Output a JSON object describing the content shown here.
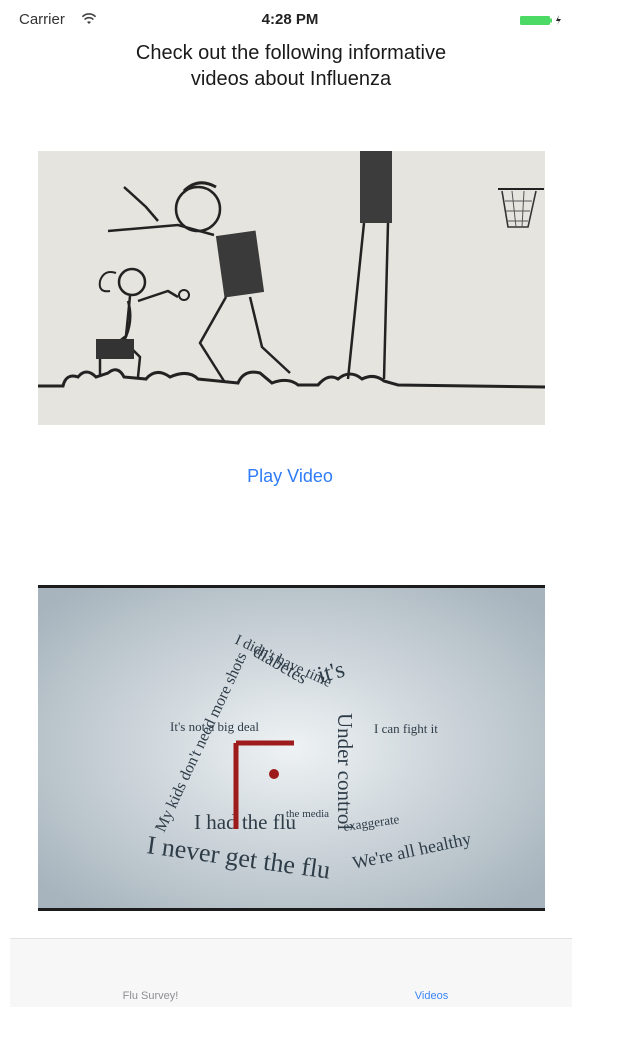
{
  "status_bar": {
    "carrier": "Carrier",
    "time": "4:28 PM"
  },
  "header": {
    "title": "Check out the following informative videos about Influenza"
  },
  "videos": [
    {
      "thumbnail": "stick-figure-basketball-illustration",
      "play_label": "Play Video"
    },
    {
      "thumbnail": "word-cloud-house-illustration",
      "overlay_text": [
        "I didn't have time",
        "diabetes",
        "it's",
        "My kids don't need more shots",
        "It's not a big deal",
        "Under control",
        "I can fight it",
        "I had the flu",
        "the media",
        "exaggerate",
        "I never get the flu",
        "We're all healthy"
      ]
    }
  ],
  "tab_bar": {
    "tabs": [
      {
        "label": "Flu Survey!",
        "active": false
      },
      {
        "label": "Videos",
        "active": true
      }
    ]
  },
  "colors": {
    "link": "#2f7cf6",
    "active_tab": "#3a86f6",
    "inactive_tab": "#8e8e93",
    "battery": "#4cd964"
  }
}
